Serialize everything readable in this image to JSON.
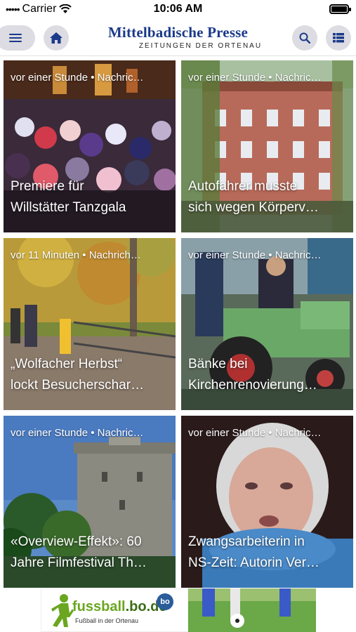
{
  "status": {
    "carrier": "Carrier",
    "time": "10:06 AM"
  },
  "header": {
    "title": "Mittelbadische Presse",
    "subtitle": "ZEITUNGEN DER ORTENAU"
  },
  "articles": [
    {
      "meta": "vor einer Stunde • Nachric…",
      "line1": "Premiere für",
      "line2": "Willstätter Tanzgala"
    },
    {
      "meta": "vor einer Stunde • Nachric…",
      "line1": "Autofahrer musste",
      "line2": "sich wegen Körperv…"
    },
    {
      "meta": "vor 11 Minuten • Nachrich…",
      "line1": "„Wolfacher Herbst“",
      "line2": "lockt Besucherschar…"
    },
    {
      "meta": "vor einer Stunde • Nachric…",
      "line1": "Bänke bei",
      "line2": "Kirchenrenovierung…"
    },
    {
      "meta": "vor einer Stunde • Nachric…",
      "line1": "«Overview-Effekt»: 60",
      "line2": "Jahre Filmfestival Th…"
    },
    {
      "meta": "vor einer Stunde • Nachric…",
      "line1": "Zwangsarbeiterin in",
      "line2": "NS-Zeit: Autorin Ver…"
    }
  ],
  "ad": {
    "logo_a": "fussball",
    "logo_b": ".bo.de",
    "tagline": "Fußball in der Ortenau",
    "badge": "bo"
  },
  "icons": {
    "menu": "menu-icon",
    "home": "home-icon",
    "search": "search-icon",
    "list": "list-icon"
  },
  "colors": {
    "brand": "#1c3a8a",
    "button_bg": "#dcdce2",
    "ad_green": "#6aa620"
  }
}
